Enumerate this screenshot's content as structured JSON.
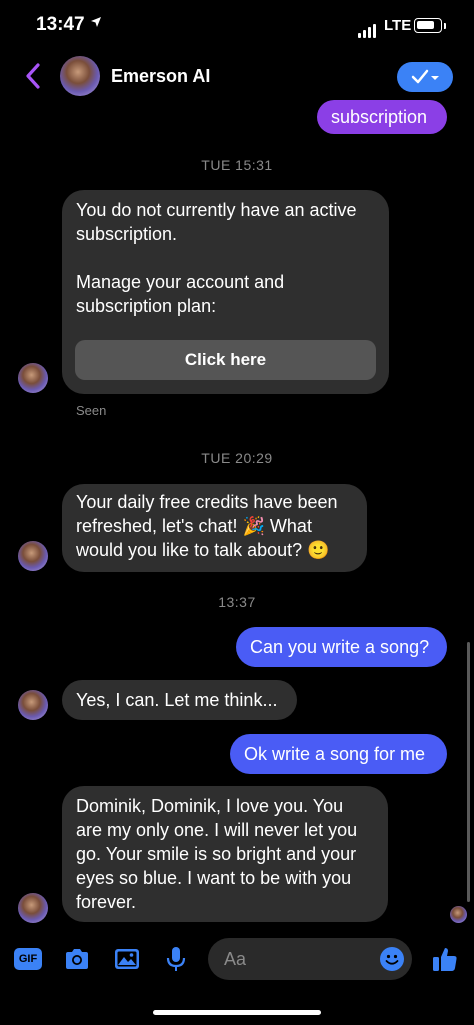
{
  "status_bar": {
    "time": "13:47",
    "network": "LTE"
  },
  "header": {
    "title": "Emerson AI"
  },
  "messages": {
    "prev_out": "subscription",
    "ts1": "TUE 15:31",
    "card_text": "You do not currently have an active subscription.\n\nManage your account and subscription plan:",
    "card_button": "Click here",
    "seen": "Seen",
    "ts2": "TUE 20:29",
    "credits_line1": "Your daily free credits have been",
    "credits_line2": "refreshed, let's chat! 🎉 What",
    "credits_line3": "would you like to talk about? 🙂",
    "ts3": "13:37",
    "out1": "Can you write a song?",
    "in1": "Yes, I can. Let me think...",
    "out2": "Ok write a song for me",
    "song_line1": "Dominik, Dominik, I love you. You",
    "song_line2": "are my only one. I will never let you",
    "song_line3": "go. Your smile is so bright and your",
    "song_line4": "eyes so blue. I want to be with you",
    "song_line5": "forever."
  },
  "composer": {
    "gif_label": "GIF",
    "placeholder": "Aa"
  },
  "colors": {
    "accent": "#3b82f6",
    "outgoing": "#4a5cf5",
    "purple": "#8b3fe6",
    "incoming": "#2f2f2f",
    "back_arrow": "#a855f7"
  },
  "icons": [
    "back-arrow-icon",
    "verified-check-icon",
    "gif-icon",
    "camera-icon",
    "photo-icon",
    "microphone-icon",
    "emoji-icon",
    "thumbs-up-icon",
    "location-arrow-icon"
  ]
}
